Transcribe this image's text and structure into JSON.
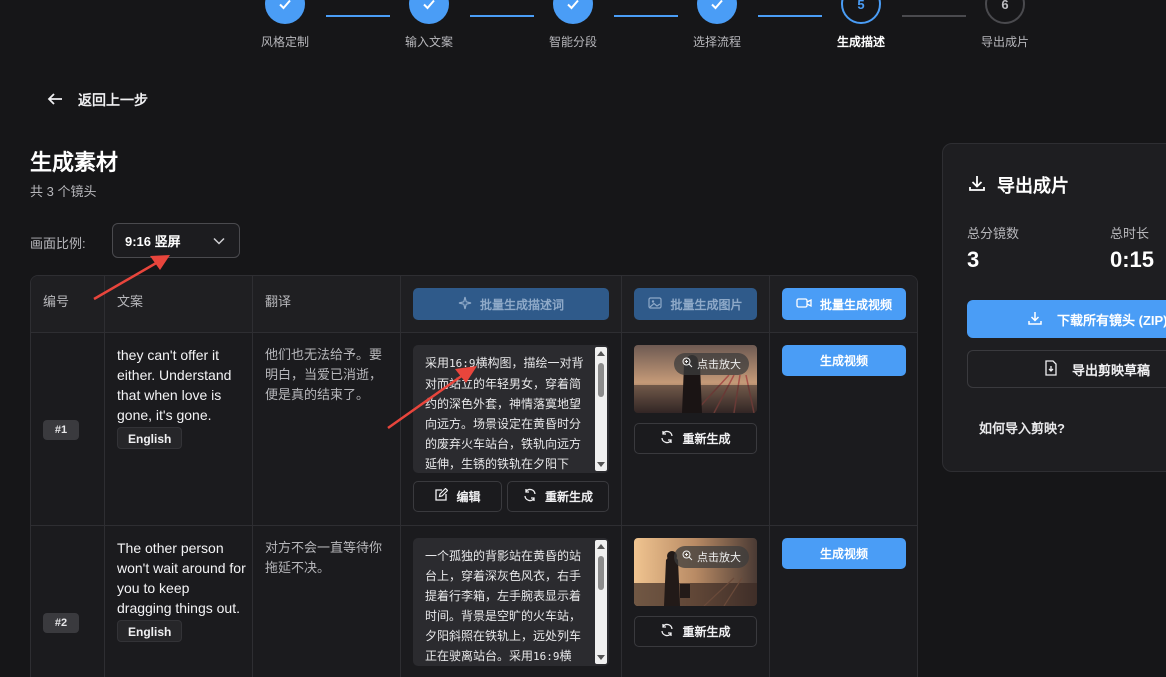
{
  "stepper": {
    "steps": [
      {
        "num": "1",
        "label": "风格定制",
        "state": "done"
      },
      {
        "num": "2",
        "label": "输入文案",
        "state": "done"
      },
      {
        "num": "3",
        "label": "智能分段",
        "state": "done"
      },
      {
        "num": "4",
        "label": "选择流程",
        "state": "done"
      },
      {
        "num": "5",
        "label": "生成描述",
        "state": "current"
      },
      {
        "num": "6",
        "label": "导出成片",
        "state": "future"
      }
    ]
  },
  "back_label": "返回上一步",
  "page_title": "生成素材",
  "subtitle": "共 3 个镜头",
  "ratio": {
    "label": "画面比例:",
    "value": "9:16 竖屏"
  },
  "table": {
    "headers": {
      "number": "编号",
      "copy": "文案",
      "translation": "翻译",
      "batch_desc": "批量生成描述词",
      "batch_image": "批量生成图片",
      "batch_video": "批量生成视频"
    },
    "rows": [
      {
        "badge": "#1",
        "copy": "they can't offer it either. Understand that when love is gone, it's gone.",
        "lang": "English",
        "translation": "他们也无法给予。要明白，当爱已消逝，便是真的结束了。",
        "desc_prefix": "采用",
        "desc_ratio": "16:9",
        "desc_rest": "横构图，描绘一对背对而站立的年轻男女，穿着简约的深色外套，神情落寞地望向远方。场景设定在黄昏时分的废弃火车站台，铁轨向远方延伸，生锈的铁轨在夕阳下",
        "edit_label": "编辑",
        "regen_label": "重新生成",
        "zoom_label": "点击放大",
        "img_regen_label": "重新生成",
        "video_label": "生成视频"
      },
      {
        "badge": "#2",
        "copy": "The other person won't wait around for you to keep dragging things out.",
        "lang": "English",
        "translation": "对方不会一直等待你拖延不决。",
        "desc_prefix": "一个孤独的背影站在黄昏的站台上，穿着深灰色风衣，右手提着行李箱，左手腕表显示着时间。背景是空旷的火车站，夕阳斜照在铁轨上，远处列车正在驶离站台。采用",
        "desc_ratio": "16:9",
        "desc_rest": "横",
        "zoom_label": "点击放大",
        "img_regen_label": "重新生成",
        "video_label": "生成视频"
      }
    ]
  },
  "export": {
    "title": "导出成片",
    "total_shots_label": "总分镜数",
    "total_shots": "3",
    "total_duration_label": "总时长",
    "total_duration": "0:15",
    "download_label": "下载所有镜头 (ZIP)",
    "draft_label": "导出剪映草稿",
    "help_label": "如何导入剪映?"
  },
  "colors": {
    "accent": "#4a9df6",
    "background": "#161618",
    "annotation_arrow": "#e8453c"
  }
}
